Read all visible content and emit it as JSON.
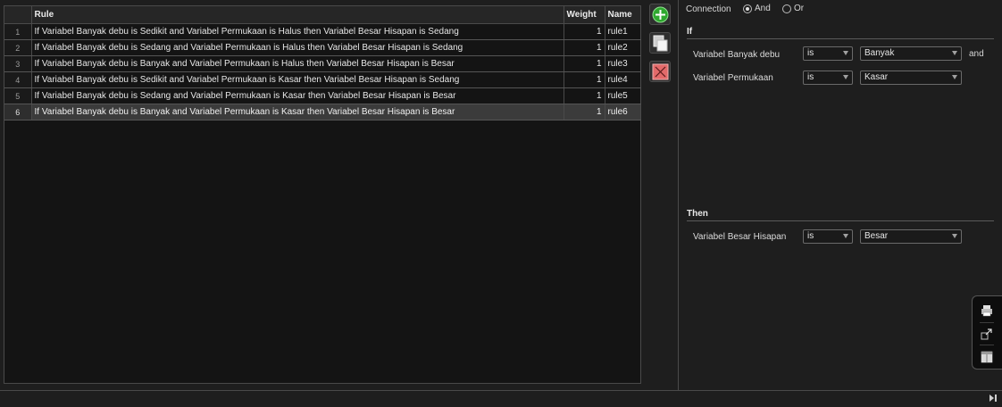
{
  "table": {
    "columns": {
      "index": "",
      "rule": "Rule",
      "weight": "Weight",
      "name": "Name"
    },
    "rows": [
      {
        "index": "1",
        "rule": "If Variabel Banyak debu is Sedikit and Variabel Permukaan is Halus then Variabel Besar Hisapan is Sedang",
        "weight": "1",
        "name": "rule1"
      },
      {
        "index": "2",
        "rule": "If Variabel Banyak debu is Sedang and Variabel Permukaan is Halus then Variabel Besar Hisapan is Sedang",
        "weight": "1",
        "name": "rule2"
      },
      {
        "index": "3",
        "rule": "If Variabel Banyak debu is Banyak and Variabel Permukaan is Halus then Variabel Besar Hisapan is Besar",
        "weight": "1",
        "name": "rule3"
      },
      {
        "index": "4",
        "rule": "If Variabel Banyak debu is Sedikit and Variabel Permukaan is Kasar then Variabel Besar Hisapan is Sedang",
        "weight": "1",
        "name": "rule4"
      },
      {
        "index": "5",
        "rule": "If Variabel Banyak debu is Sedang and Variabel Permukaan is Kasar then Variabel Besar Hisapan is Besar",
        "weight": "1",
        "name": "rule5"
      },
      {
        "index": "6",
        "rule": "If Variabel Banyak debu is Banyak and Variabel Permukaan is Kasar then Variabel Besar Hisapan is Besar",
        "weight": "1",
        "name": "rule6"
      }
    ],
    "selected_row": "6"
  },
  "toolbar": {
    "add_icon": "add-rule-icon",
    "duplicate_icon": "duplicate-rule-icon",
    "delete_icon": "delete-rule-icon"
  },
  "connection": {
    "label": "Connection",
    "and_label": "And",
    "or_label": "Or",
    "selected": "And"
  },
  "if_section": {
    "title": "If",
    "and_text": "and",
    "inputs": [
      {
        "variable": "Variabel Banyak debu",
        "operator": "is",
        "value": "Banyak"
      },
      {
        "variable": "Variabel Permukaan",
        "operator": "is",
        "value": "Kasar"
      }
    ]
  },
  "then_section": {
    "title": "Then",
    "outputs": [
      {
        "variable": "Variabel Besar Hisapan",
        "operator": "is",
        "value": "Besar"
      }
    ]
  },
  "side_tools": [
    "print-icon",
    "undock-icon",
    "layout-icon"
  ],
  "colors": {
    "add": "#3fbf3f",
    "delete": "#e06060",
    "selected_row": "#3b3b3b"
  }
}
